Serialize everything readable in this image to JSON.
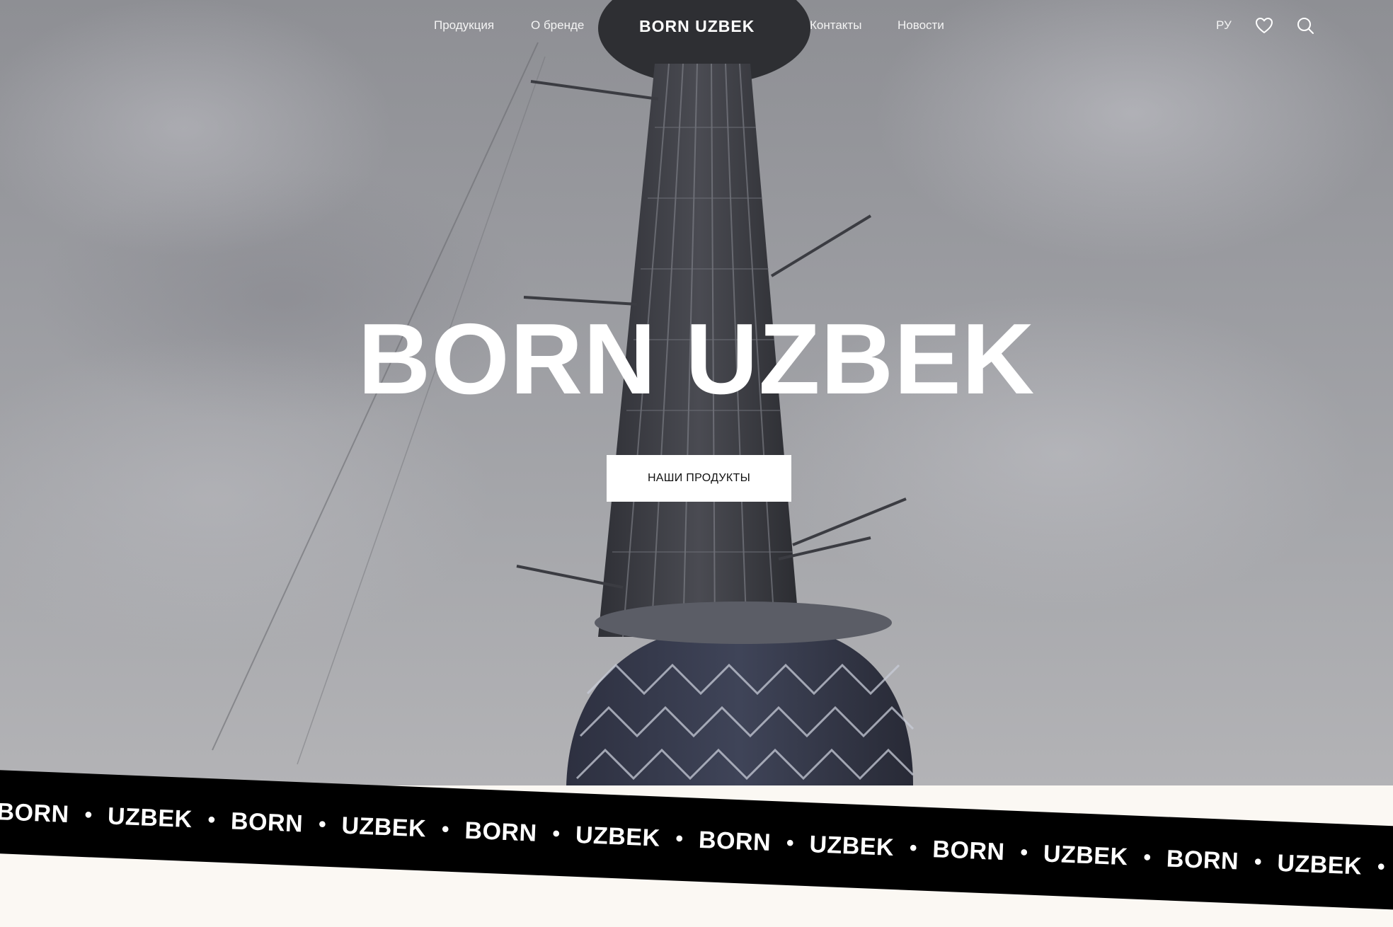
{
  "nav": {
    "links_left": [
      "Продукция",
      "О бренде"
    ],
    "logo": "BORN UZBEK",
    "links_right": [
      "Контакты",
      "Новости"
    ],
    "lang": "РУ",
    "icons": [
      "heart-icon",
      "search-icon"
    ]
  },
  "hero": {
    "title": "BORN UZBEK",
    "cta_label": "НАШИ ПРОДУКТЫ",
    "background": "tashkent-tv-tower-photo"
  },
  "marquee": {
    "word1": "BORN",
    "word2": "UZBEK",
    "separator": "•"
  },
  "colors": {
    "band": "#000000",
    "page_bg": "#fbf8f3",
    "text_light": "#ffffff"
  }
}
